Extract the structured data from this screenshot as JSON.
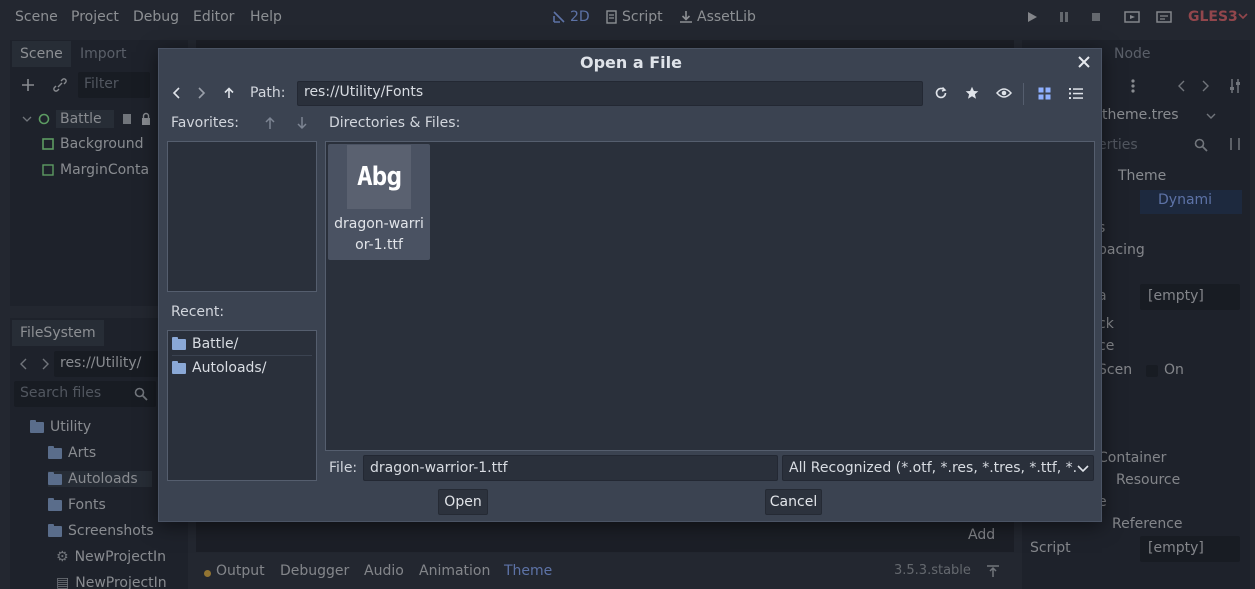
{
  "menu": [
    "Scene",
    "Project",
    "Debug",
    "Editor",
    "Help"
  ],
  "workspaces": [
    {
      "label": "2D",
      "icon": "2d-icon",
      "active": true
    },
    {
      "label": "Script",
      "icon": "script-icon",
      "active": false
    },
    {
      "label": "AssetLib",
      "icon": "assetlib-icon",
      "active": false
    }
  ],
  "renderer": "GLES3",
  "left_dock": {
    "tabs": [
      "Scene",
      "Import"
    ],
    "filter_placeholder": "Filter",
    "scene_tree": [
      {
        "label": "Battle",
        "icon": "control-node-icon"
      },
      {
        "label": "Background",
        "icon": "color-rect-icon"
      },
      {
        "label": "MarginConta",
        "icon": "margin-container-icon"
      }
    ],
    "filesystem_tab": "FileSystem",
    "fs_path": "res://Utility/",
    "search_placeholder": "Search files",
    "fs_items": [
      "Utility",
      "Arts",
      "Autoloads",
      "Fonts",
      "Screenshots",
      "NewProjectIn",
      "NewProjectIn"
    ]
  },
  "right_dock": {
    "tab": "Node",
    "resource": "theme.tres",
    "filter_placeholder": "erties",
    "theme_label": "Theme",
    "dynamic_label": "Dynami",
    "row_fragments": [
      "s",
      "pacing",
      "a",
      "ck",
      "ce",
      "Scen",
      "Container",
      "Resource",
      "e",
      "Reference"
    ],
    "empty_value": "[empty]",
    "on_label": "On",
    "script_label": "Script",
    "script_value": "[empty]"
  },
  "bottom_panel": {
    "tabs": [
      "Output",
      "Debugger",
      "Audio",
      "Animation",
      "Theme"
    ],
    "active_tab": "Theme",
    "version": "3.5.3.stable",
    "add_label": "Add"
  },
  "dialog": {
    "title": "Open a File",
    "path_label": "Path:",
    "path_value": "res://Utility/Fonts",
    "favorites_label": "Favorites:",
    "dirs_label": "Directories & Files:",
    "recent_label": "Recent:",
    "recent_items": [
      "Battle/",
      "Autoloads/"
    ],
    "file_tile": {
      "preview_text": "Abg",
      "name_line1": "dragon-warri",
      "name_line2": "or-1.ttf"
    },
    "file_label": "File:",
    "file_value": "dragon-warrior-1.ttf",
    "filter_value": "All Recognized (*.otf, *.res, *.tres, *.ttf, *.",
    "open_label": "Open",
    "cancel_label": "Cancel"
  },
  "colors": {
    "accent": "#8fb0ff",
    "gles": "#e06c75",
    "dialog_bg": "#3b4351"
  }
}
